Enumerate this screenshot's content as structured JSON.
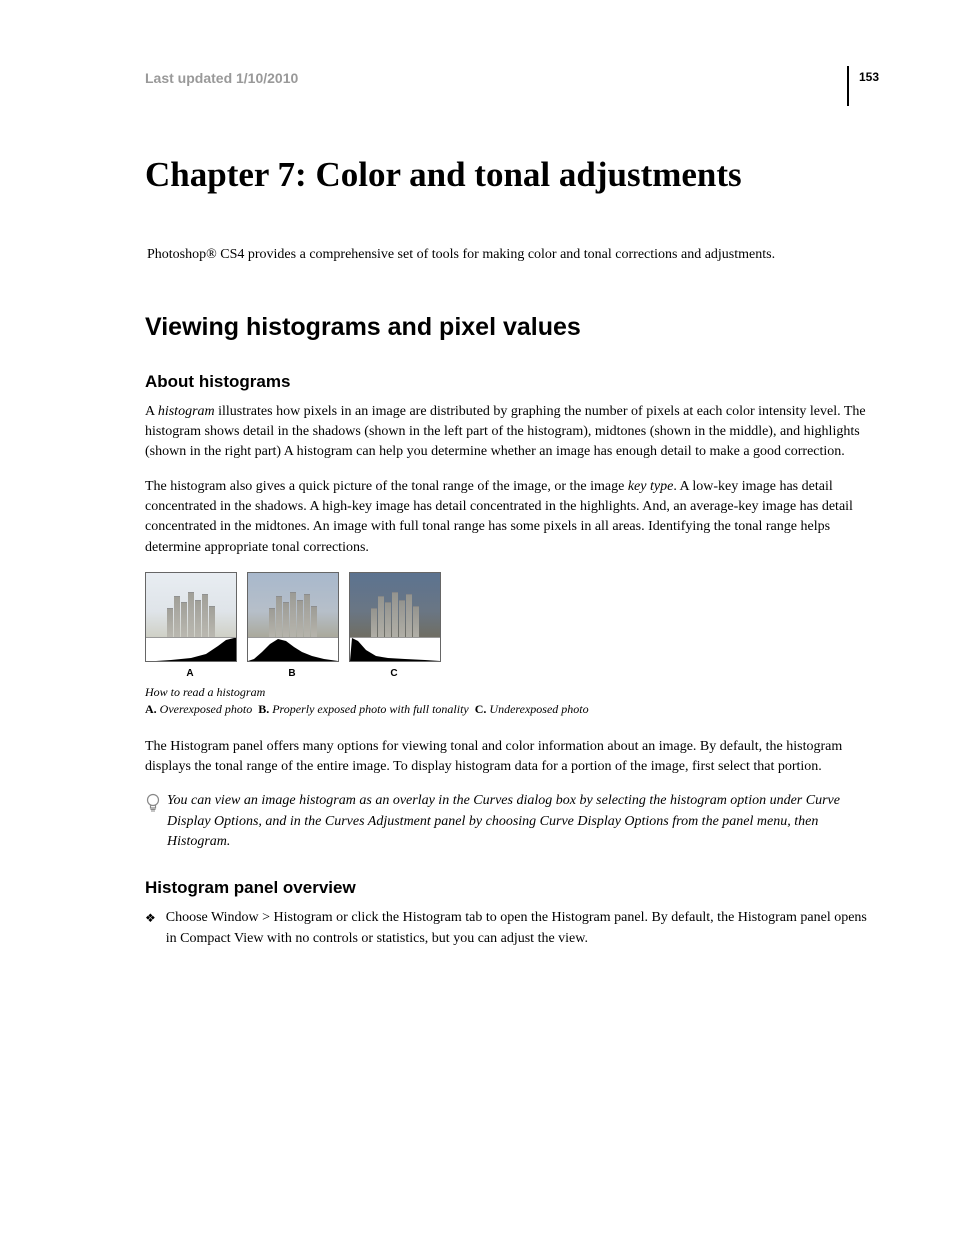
{
  "header": {
    "last_updated": "Last updated 1/10/2010",
    "page_number": "153"
  },
  "chapter": {
    "title": "Chapter 7: Color and tonal adjustments",
    "intro": "Photoshop® CS4 provides a comprehensive set of tools for making color and tonal corrections and adjustments."
  },
  "section": {
    "title": "Viewing histograms and pixel values"
  },
  "sub1": {
    "title": "About histograms",
    "p1a": "A ",
    "p1b": "histogram",
    "p1c": " illustrates how pixels in an image are distributed by graphing the number of pixels at each color intensity level. The histogram shows detail in the shadows (shown in the left part of the histogram), midtones (shown in the middle), and highlights (shown in the right part) A histogram can help you determine whether an image has enough detail to make a good correction.",
    "p2a": "The histogram also gives a quick picture of the tonal range of the image, or the image ",
    "p2b": "key type",
    "p2c": ". A low-key image has detail concentrated in the shadows. A high-key image has detail concentrated in the highlights. And, an average-key image has detail concentrated in the midtones. An image with full tonal range has some pixels in all areas. Identifying the tonal range helps determine appropriate tonal corrections."
  },
  "figure": {
    "labels": {
      "a": "A",
      "b": "B",
      "c": "C"
    },
    "caption": "How to read a histogram",
    "detail": {
      "a_lbl": "A.",
      "a_txt": "Overexposed photo",
      "b_lbl": "B.",
      "b_txt": "Properly exposed photo with full tonality",
      "c_lbl": "C.",
      "c_txt": "Underexposed photo"
    }
  },
  "p3": "The Histogram panel offers many options for viewing tonal and color information about an image. By default, the histogram displays the tonal range of the entire image. To display histogram data for a portion of the image, first select that portion.",
  "tip": "You can view an image histogram as an overlay in the Curves dialog box by selecting the histogram option under Curve Display Options, and in the Curves Adjustment panel by choosing Curve Display Options from the panel menu, then Histogram.",
  "sub2": {
    "title": "Histogram panel overview",
    "bullet": "Choose Window > Histogram or click the Histogram tab to open the Histogram panel. By default, the Histogram panel opens in Compact View with no controls or statistics, but you can adjust the view."
  }
}
